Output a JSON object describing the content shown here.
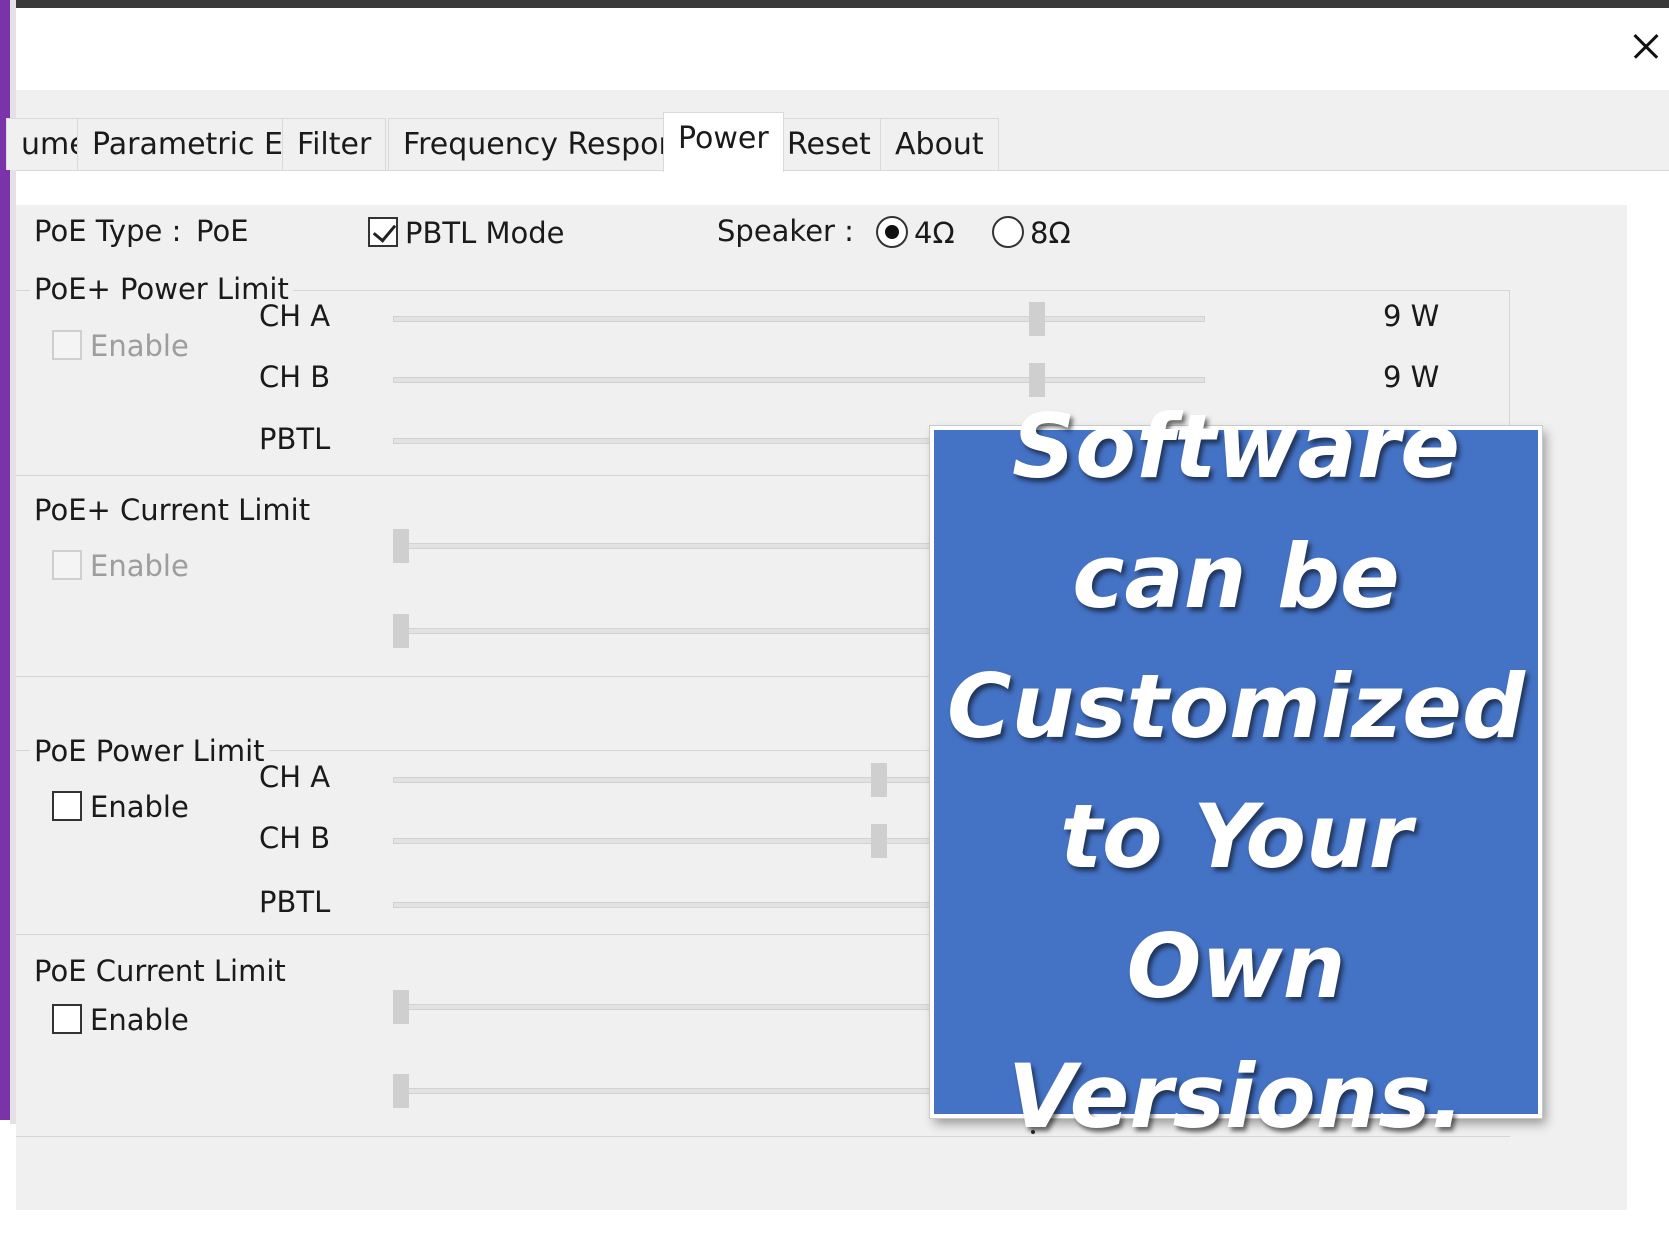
{
  "tabs": [
    {
      "label": "ume"
    },
    {
      "label": "Parametric EQ"
    },
    {
      "label": "Filter"
    },
    {
      "label": "Frequency Respond"
    },
    {
      "label": "Power",
      "active": true
    },
    {
      "label": "Reset"
    },
    {
      "label": "About"
    }
  ],
  "header": {
    "poe_type_label": "PoE Type :",
    "poe_type_value": "PoE",
    "pbtl_mode_label": "PBTL Mode",
    "pbtl_mode_checked": true,
    "speaker_label": "Speaker :",
    "speaker_options": [
      {
        "label": "4Ω",
        "selected": true
      },
      {
        "label": "8Ω",
        "selected": false
      }
    ]
  },
  "groups": {
    "poe_plus_power_limit": {
      "title": "PoE+ Power Limit",
      "enable_label": "Enable",
      "enable_checked": false,
      "enable_disabled": true,
      "channels": [
        {
          "label": "CH A",
          "value": "9 W",
          "level": 0.79
        },
        {
          "label": "CH B",
          "value": "9 W",
          "level": 0.79
        },
        {
          "label": "PBTL",
          "value": "",
          "level": null
        }
      ]
    },
    "poe_plus_current_limit": {
      "title": "PoE+ Current Limit",
      "enable_label": "Enable",
      "enable_checked": false,
      "enable_disabled": true,
      "sliders": [
        {
          "level": 0.0
        },
        {
          "level": 0.0
        }
      ]
    },
    "poe_power_limit": {
      "title": "PoE Power Limit",
      "enable_label": "Enable",
      "enable_checked": false,
      "enable_disabled": false,
      "channels": [
        {
          "label": "CH A",
          "value": "",
          "level": 0.6
        },
        {
          "label": "CH B",
          "value": "",
          "level": 0.6
        },
        {
          "label": "PBTL",
          "value": "",
          "level": null
        }
      ]
    },
    "poe_current_limit": {
      "title": "PoE Current Limit",
      "enable_label": "Enable",
      "enable_checked": false,
      "enable_disabled": false,
      "sliders": [
        {
          "level": 0.0
        },
        {
          "level": 0.0
        }
      ]
    }
  },
  "overlay": {
    "lines": [
      "Software",
      "can be",
      "Customized",
      "to Your Own",
      "Versions."
    ],
    "background": "#4472c4",
    "text_color": "#ffffff"
  },
  "colors": {
    "window_accent": "#7a33a8",
    "panel_bg": "#f0f0f0"
  }
}
